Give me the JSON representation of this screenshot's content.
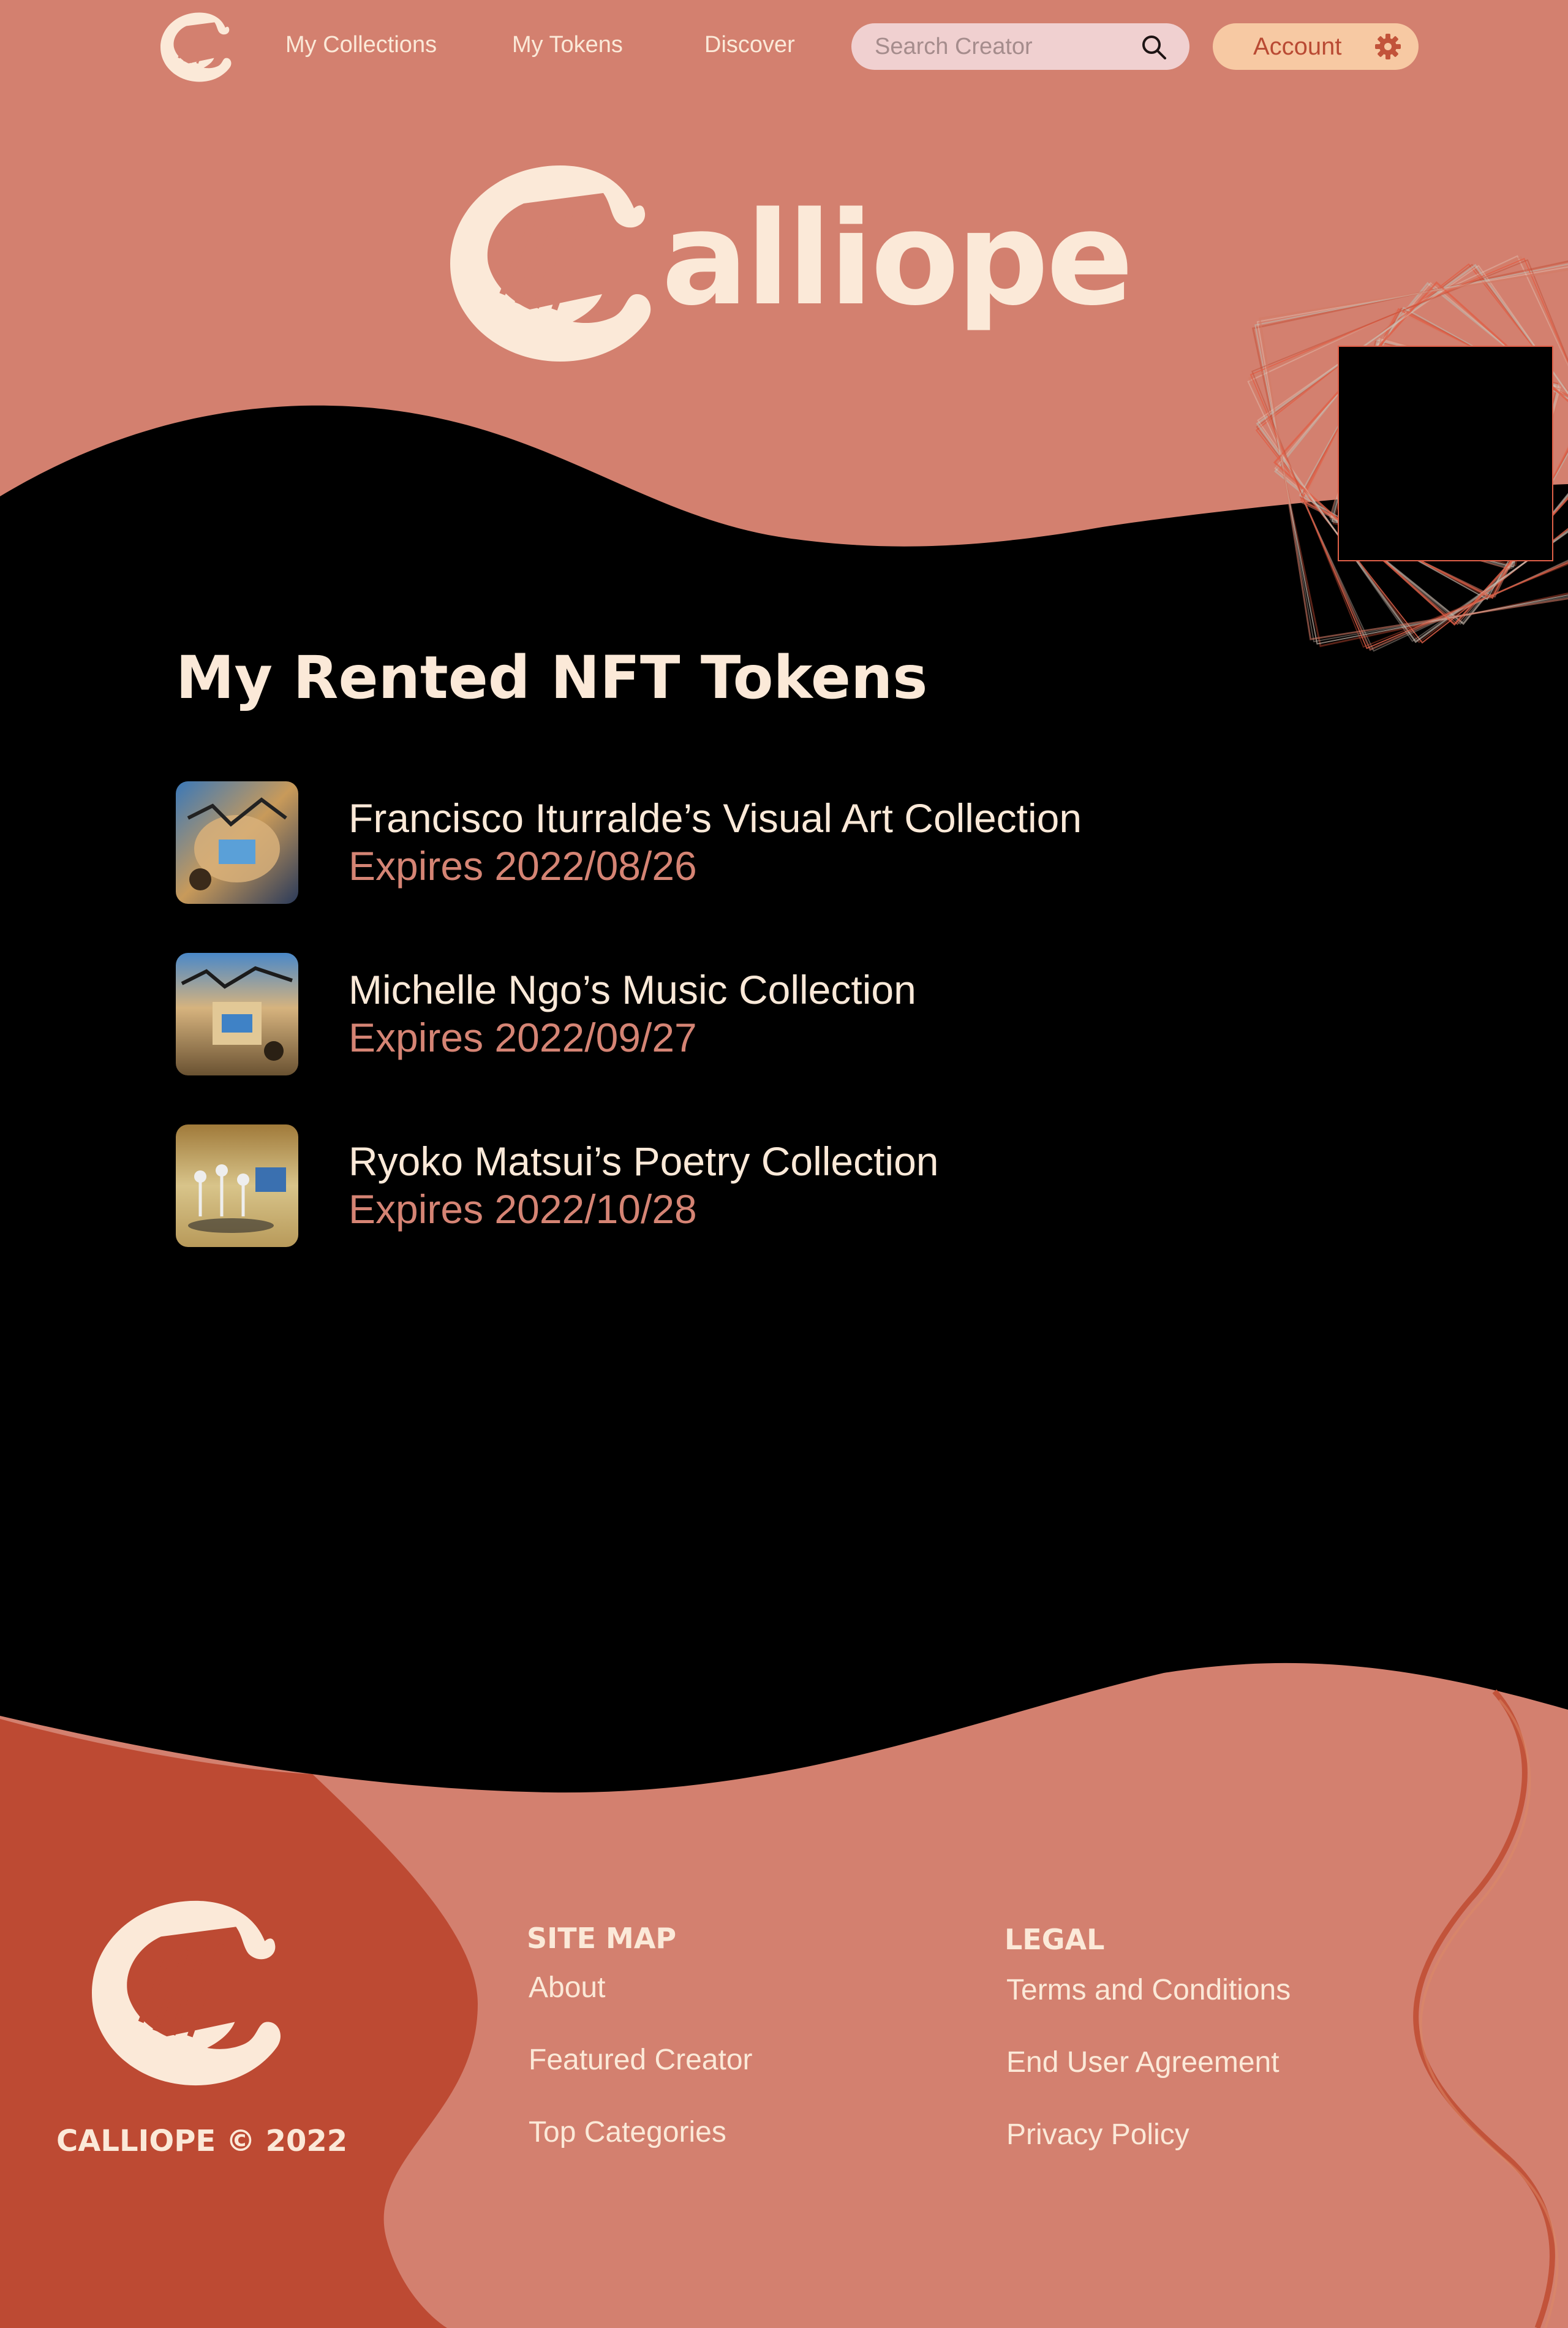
{
  "colors": {
    "salmon": "#d3806f",
    "dark": "#000000",
    "cream": "#fbe9d8",
    "brick": "#bd4a33",
    "accent_text": "#d58474",
    "search_bg": "#f0d0d0",
    "account_bg": "#f7c9a3"
  },
  "nav": {
    "links": [
      "My Collections",
      "My Tokens",
      "Discover"
    ],
    "search_placeholder": "Search Creator",
    "account_label": "Account",
    "icons": [
      "harp-logo-icon",
      "search-icon",
      "gear-icon"
    ]
  },
  "hero": {
    "word": "alliope"
  },
  "main": {
    "title": "My Rented NFT Tokens",
    "tokens": [
      {
        "name": "Francisco Iturralde’s Visual Art Collection",
        "expiry": "Expires 2022/08/26"
      },
      {
        "name": "Michelle Ngo’s Music Collection",
        "expiry": "Expires 2022/09/27"
      },
      {
        "name": "Ryoko Matsui’s Poetry Collection",
        "expiry": "Expires 2022/10/28"
      }
    ]
  },
  "footer": {
    "copyright": "CALLIOPE © 2022",
    "sitemap": {
      "heading": "SITE MAP",
      "links": [
        "About",
        "Featured Creator",
        "Top Categories"
      ]
    },
    "legal": {
      "heading": "LEGAL",
      "links": [
        "Terms and Conditions",
        "End User Agreement",
        "Privacy Policy"
      ]
    }
  }
}
